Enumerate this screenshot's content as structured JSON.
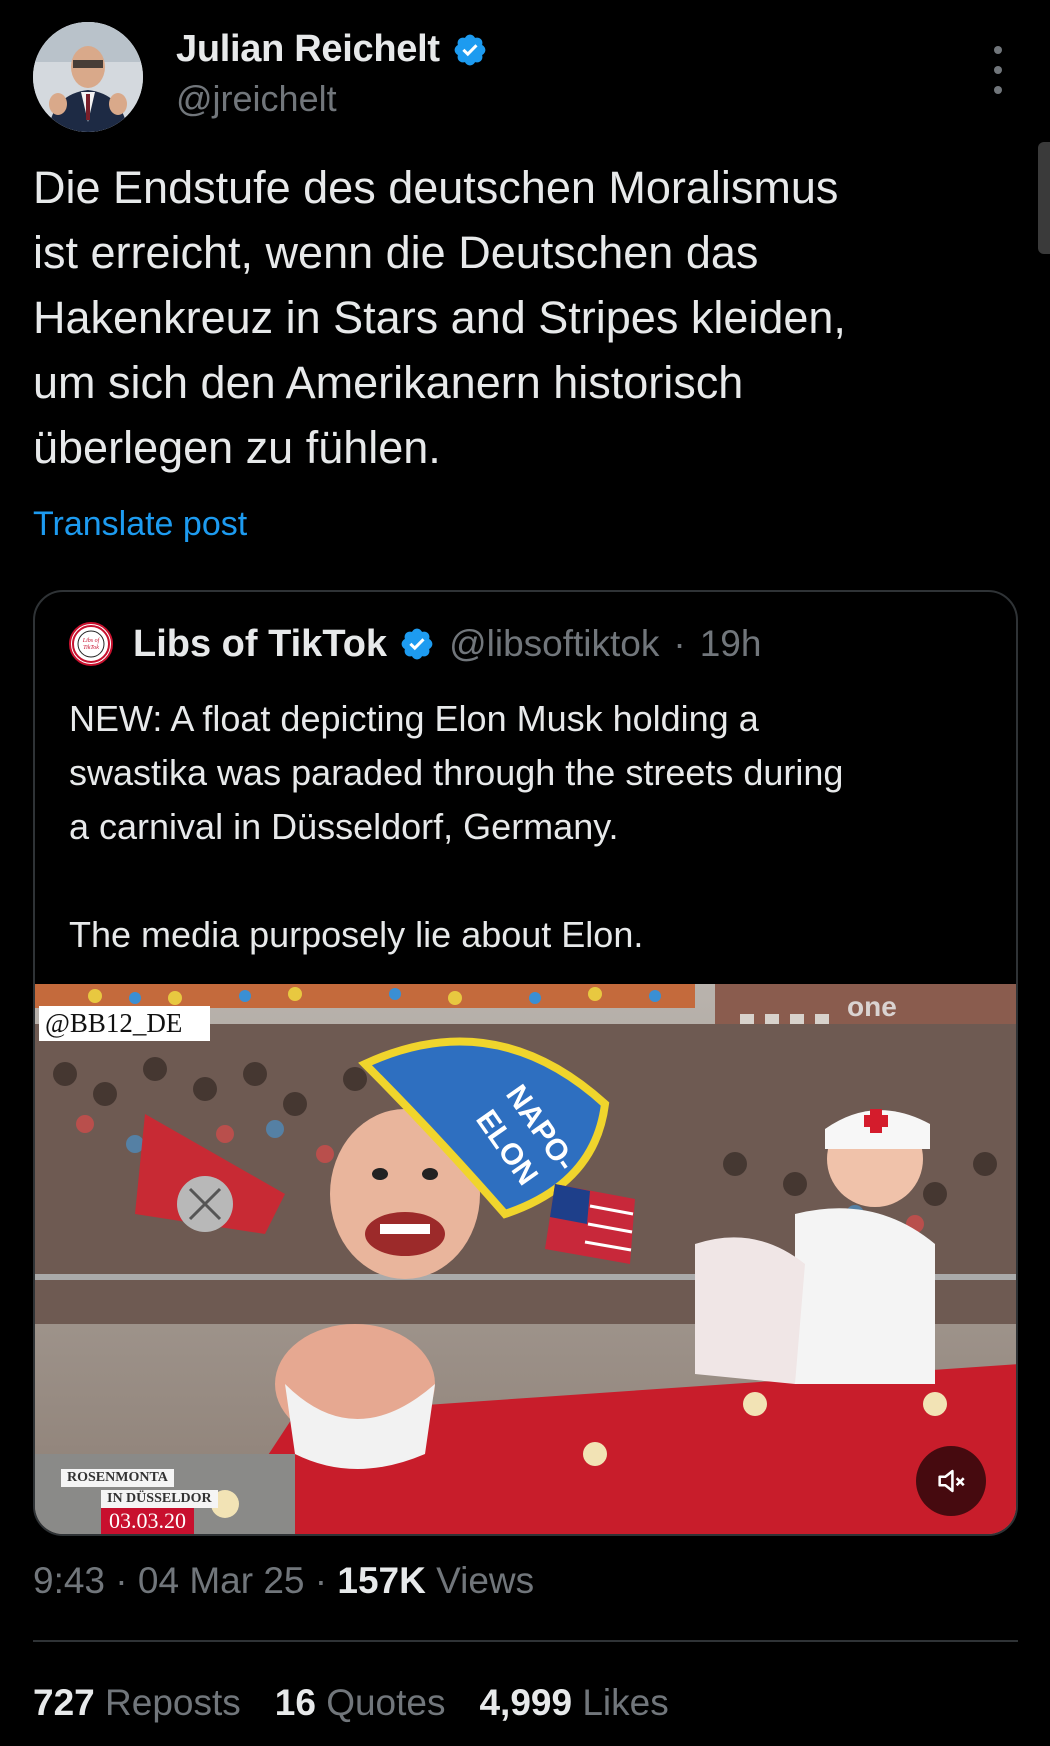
{
  "author": {
    "name": "Julian Reichelt",
    "handle": "@jreichelt"
  },
  "tweet": {
    "text": "Die Endstufe des deutschen Moralismus\nist erreicht, wenn die Deutschen das\nHakenkreuz in Stars and Stripes kleiden,\num sich den Amerikanern historisch\nüberlegen zu fühlen.",
    "translate_label": "Translate post"
  },
  "quote": {
    "avatar_text": "Libs of TikTok",
    "name": "Libs of TikTok",
    "handle": "@libsoftiktok",
    "separator": "·",
    "time": "19h",
    "text": "NEW: A float depicting Elon Musk holding a\nswastika was paraded through the streets during\na carnival in Düsseldorf, Germany.\n\nThe media purposely lie about Elon.",
    "media": {
      "watermark": "@BB12_DE",
      "lower_third_line1": "ROSENMONTA",
      "lower_third_line2": "IN DÜSSELDOR",
      "lower_third_date": "03.03.20",
      "hat_text_1": "NAPO-",
      "hat_text_2": "ELON",
      "top_right_logo": "one"
    }
  },
  "meta": {
    "time": "9:43",
    "date": "04 Mar 25",
    "dot": "·",
    "views_count": "157K",
    "views_label": "Views"
  },
  "stats": {
    "reposts_count": "727",
    "reposts_label": "Reposts",
    "quotes_count": "16",
    "quotes_label": "Quotes",
    "likes_count": "4,999",
    "likes_label": "Likes"
  },
  "colors": {
    "background": "#000000",
    "text": "#e7e9ea",
    "muted": "#71767b",
    "link": "#1d9bf0",
    "verified": "#1d9bf0",
    "border": "#2f3336"
  },
  "icons": [
    "verified-badge-icon",
    "more-options-icon",
    "mute-icon"
  ]
}
